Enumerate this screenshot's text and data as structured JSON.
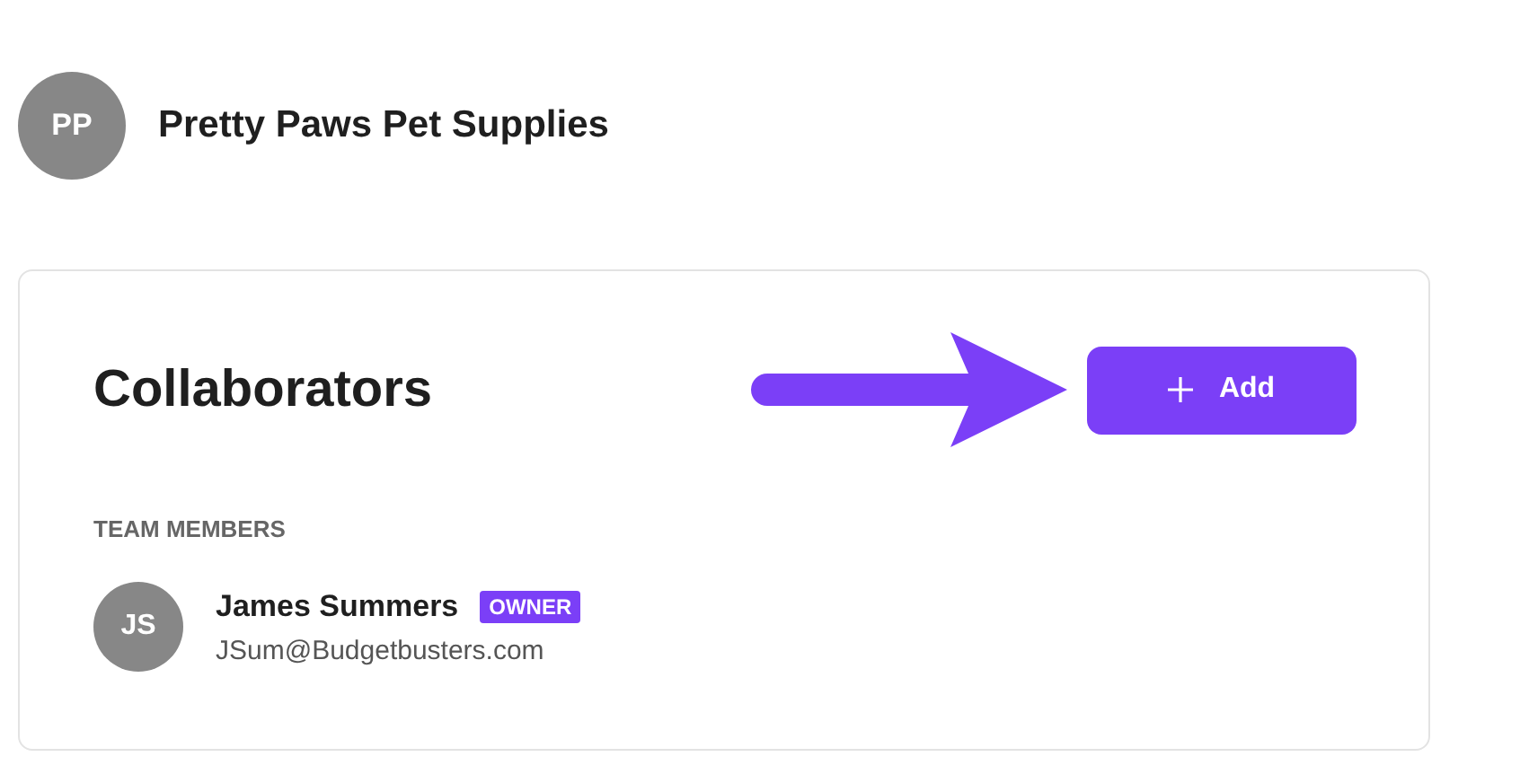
{
  "account": {
    "initials": "PP",
    "name": "Pretty Paws Pet Supplies"
  },
  "collaborators": {
    "title": "Collaborators",
    "add_button": "Add",
    "section_label": "TEAM MEMBERS",
    "members": [
      {
        "initials": "JS",
        "name": "James Summers",
        "badge": "OWNER",
        "email": "JSum@Budgetbusters.com"
      }
    ]
  }
}
